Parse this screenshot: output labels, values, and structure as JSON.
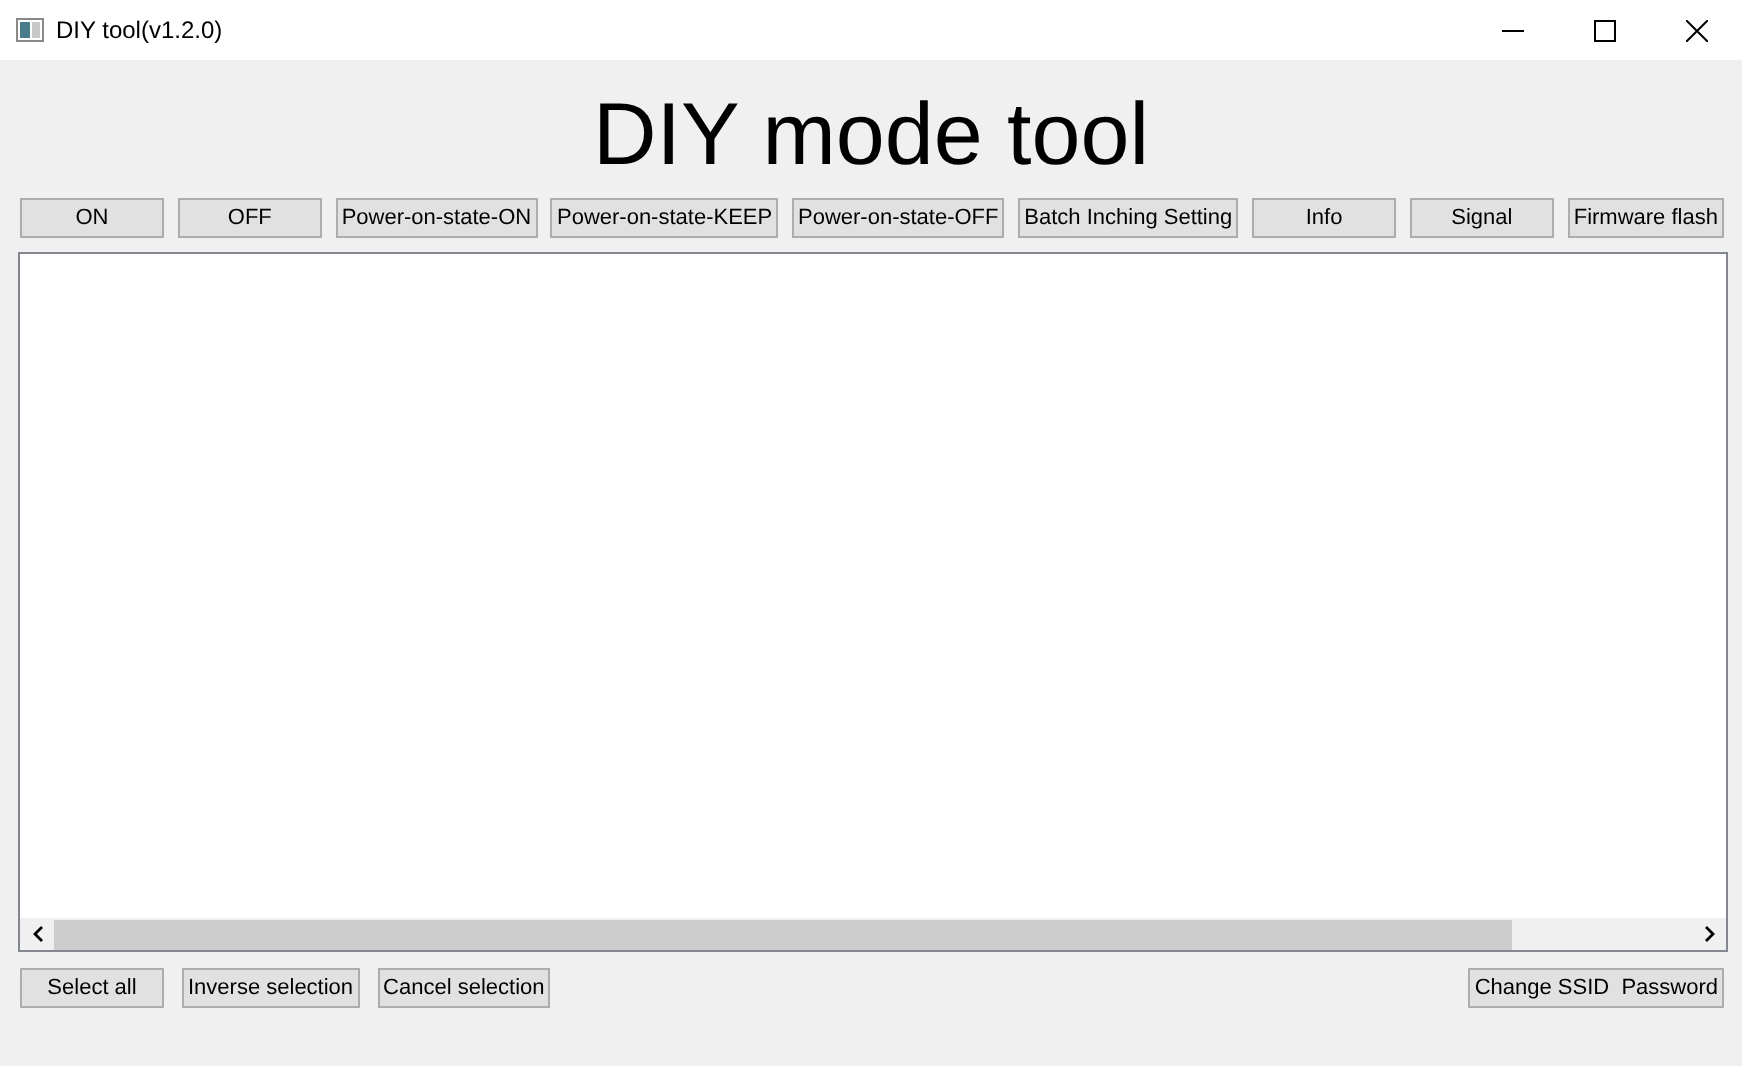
{
  "window": {
    "title": "DIY tool(v1.2.0)"
  },
  "heading": "DIY mode tool",
  "toolbar_buttons": [
    "ON",
    "OFF",
    "Power-on-state-ON",
    "Power-on-state-KEEP",
    "Power-on-state-OFF",
    "Batch Inching Setting",
    "Info",
    "Signal",
    "Firmware flash"
  ],
  "selection_buttons": [
    "Select all",
    "Inverse selection",
    "Cancel selection"
  ],
  "ssid_button": "Change SSID  Password"
}
